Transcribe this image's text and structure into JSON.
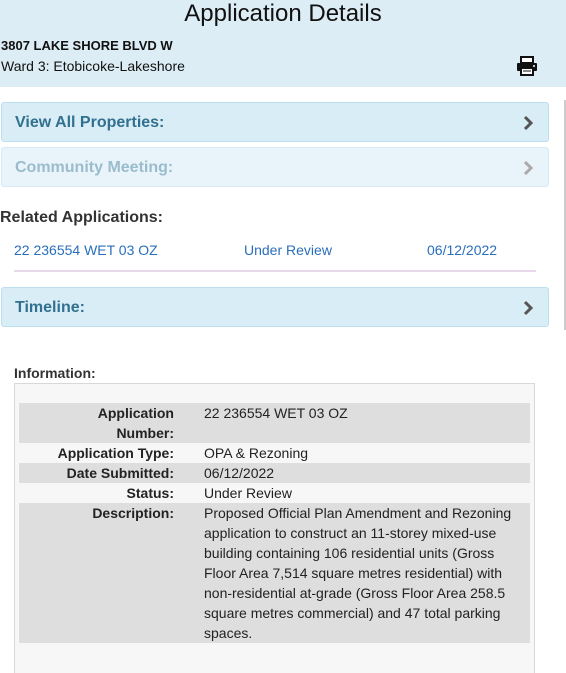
{
  "header": {
    "title": "Application Details",
    "address": "3807 LAKE SHORE BLVD W",
    "ward": "Ward 3: Etobicoke-Lakeshore",
    "print_icon": "printer-icon"
  },
  "panels": {
    "view_all": "View All Properties:",
    "community": "Community Meeting:",
    "timeline": "Timeline:"
  },
  "related": {
    "title": "Related Applications:",
    "rows": [
      {
        "number": "22 236554 WET 03 OZ",
        "status": "Under Review",
        "date": "06/12/2022"
      }
    ]
  },
  "information": {
    "title": "Information:",
    "fields": [
      {
        "label_line1": "Application",
        "label_line2": "Number:",
        "value": "22 236554 WET 03 OZ"
      },
      {
        "label": "Application Type:",
        "value": "OPA & Rezoning"
      },
      {
        "label": "Date Submitted:",
        "value": "06/12/2022"
      },
      {
        "label": "Status:",
        "value": "Under Review"
      },
      {
        "label": "Description:",
        "value": "Proposed Official Plan Amendment and Rezoning application to construct an 11-storey mixed-use building containing 106 residential units (Gross Floor Area 7,514 square metres residential) with non-residential at-grade (Gross Floor Area 258.5 square metres commercial) and 47 total parking spaces."
      }
    ]
  },
  "colors": {
    "header_bg": "#dcedf5",
    "panel_bg": "#d9edf7",
    "panel_text": "#31708f",
    "link": "#2a6ebb"
  }
}
